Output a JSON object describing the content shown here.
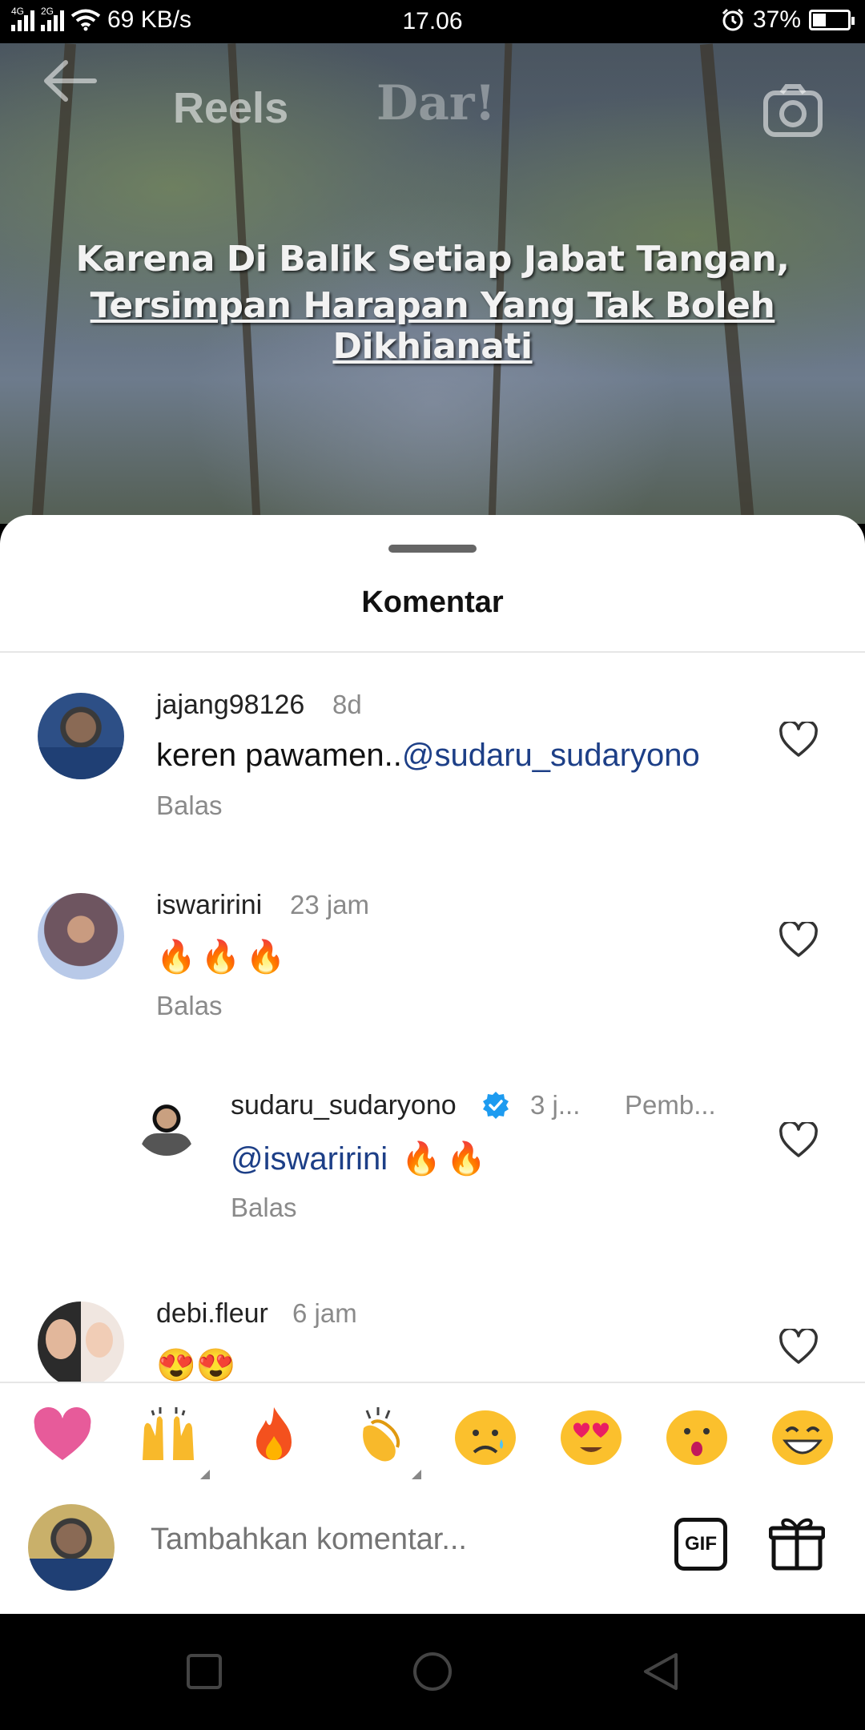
{
  "status_bar": {
    "network_left": "4G",
    "network_right": "2G",
    "speed": "69 KB/s",
    "time": "17.06",
    "battery": "37%",
    "battery_level": 0.37
  },
  "video": {
    "title": "Reels",
    "logo_text": "Dar!",
    "caption_line1": "Karena Di Balik Setiap Jabat Tangan,",
    "caption_line2": "Tersimpan Harapan Yang Tak Boleh Dikhianati"
  },
  "sheet": {
    "title": "Komentar"
  },
  "comments": [
    {
      "username": "jajang98126",
      "time": "8d",
      "text_plain": "keren pawamen..",
      "text_mention": "@sudaru_sudaryono",
      "reply_label": "Balas"
    },
    {
      "username": "iswaririni",
      "time": "23 jam",
      "text_plain": "🔥🔥🔥",
      "reply_label": "Balas"
    },
    {
      "username": "sudaru_sudaryono",
      "verified": true,
      "time": "3 j...",
      "author_label": "Pemb...",
      "text_mention": "@iswaririni",
      "text_plain": " 🔥🔥",
      "reply_label": "Balas"
    },
    {
      "username": "debi.fleur",
      "time": "6 jam",
      "text_plain": "😍😍"
    }
  ],
  "quick_emojis": [
    "heart",
    "raised-hands",
    "fire",
    "clapping-hands",
    "sad-tear-face",
    "heart-eyes-face",
    "surprised-face",
    "grinning-face"
  ],
  "input": {
    "placeholder": "Tambahkan komentar..."
  },
  "buttons": {
    "gif_label": "GIF"
  },
  "colors": {
    "mention": "#1d3f87",
    "verified": "#1d9bf0",
    "secondary_text": "#8a8a8a"
  }
}
